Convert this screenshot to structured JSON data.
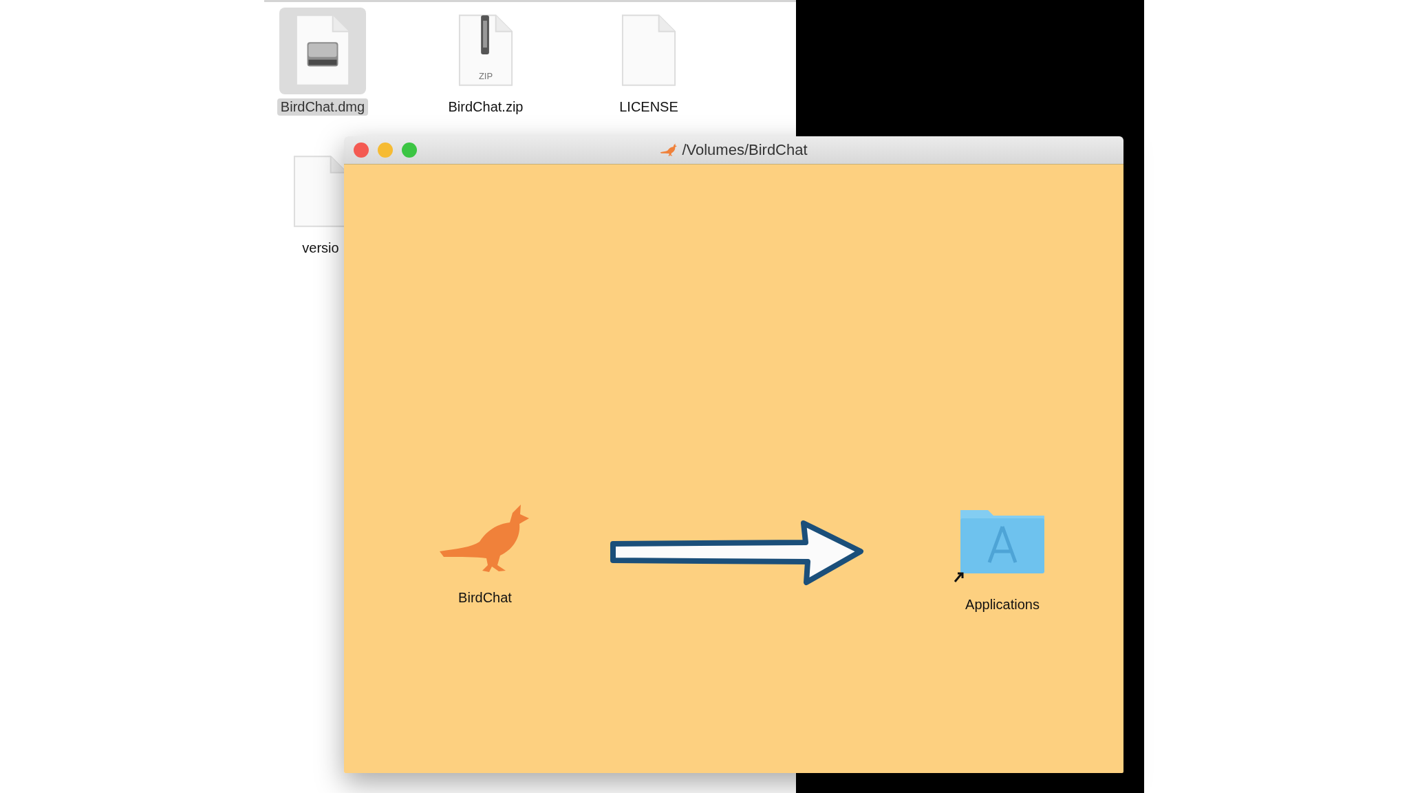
{
  "finder": {
    "files": [
      {
        "name": "BirdChat.dmg",
        "kind": "disk-image",
        "selected": true
      },
      {
        "name": "BirdChat.zip",
        "kind": "zip",
        "badge": "ZIP",
        "selected": false
      },
      {
        "name": "LICENSE",
        "kind": "document",
        "selected": false
      },
      {
        "name": "versio",
        "kind": "document",
        "selected": false
      }
    ]
  },
  "dmg_window": {
    "title": "/Volumes/BirdChat",
    "items": [
      {
        "name": "BirdChat",
        "kind": "app"
      },
      {
        "name": "Applications",
        "kind": "folder-alias"
      }
    ]
  }
}
